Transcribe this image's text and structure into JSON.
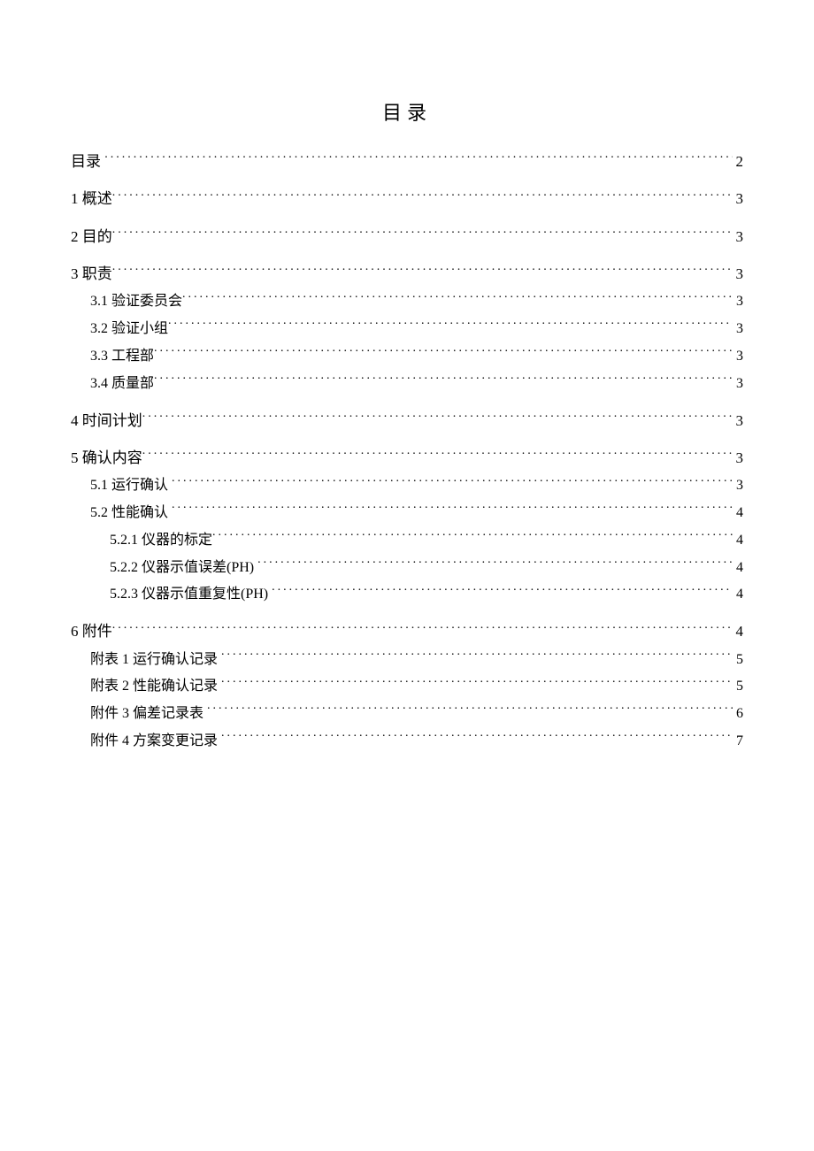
{
  "title": "目录",
  "entries": [
    {
      "level": 1,
      "label": "目录",
      "page": "2"
    },
    {
      "level": 1,
      "label": "1 概述",
      "page": "3"
    },
    {
      "level": 1,
      "label": "2 目的",
      "page": "3"
    },
    {
      "level": 1,
      "label": "3 职责",
      "page": "3"
    },
    {
      "level": 2,
      "label": "3.1 验证委员会",
      "page": "3"
    },
    {
      "level": 2,
      "label": "3.2 验证小组",
      "page": "3"
    },
    {
      "level": 2,
      "label": "3.3 工程部",
      "page": "3"
    },
    {
      "level": 2,
      "label": "3.4 质量部",
      "page": "3"
    },
    {
      "level": 1,
      "label": "4 时间计划",
      "page": "3"
    },
    {
      "level": 1,
      "label": "5 确认内容",
      "page": "3"
    },
    {
      "level": 2,
      "label": "5.1 运行确认",
      "page": "3"
    },
    {
      "level": 2,
      "label": "5.2 性能确认",
      "page": "4"
    },
    {
      "level": 3,
      "label": "5.2.1 仪器的标定",
      "page": "4"
    },
    {
      "level": 3,
      "label": "5.2.2 仪器示值误差(PH)",
      "page": "4"
    },
    {
      "level": 3,
      "label": "5.2.3 仪器示值重复性(PH)",
      "page": "4"
    },
    {
      "level": 1,
      "label": "6 附件",
      "page": "4"
    },
    {
      "level": 2,
      "label": "附表 1 运行确认记录",
      "page": "5"
    },
    {
      "level": 2,
      "label": "附表 2 性能确认记录",
      "page": "5"
    },
    {
      "level": 2,
      "label": "附件 3 偏差记录表",
      "page": "6"
    },
    {
      "level": 2,
      "label": "附件 4 方案变更记录",
      "page": "7"
    }
  ]
}
